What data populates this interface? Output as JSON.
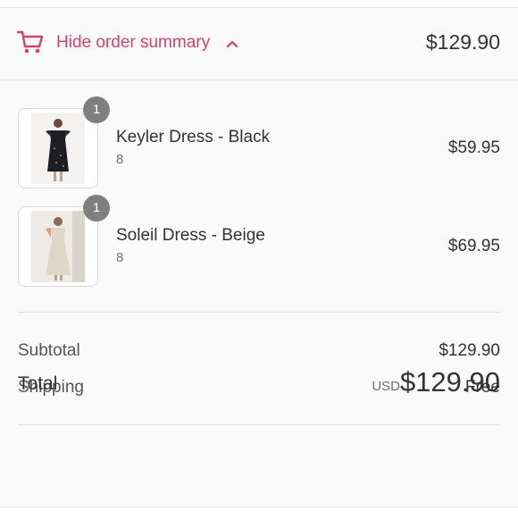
{
  "summary_toggle": {
    "label": "Hide order summary",
    "total": "$129.90",
    "icon": "cart-icon",
    "accent_color": "#d4426c"
  },
  "line_items": [
    {
      "name": "Keyler Dress - Black",
      "variant": "8",
      "price": "$59.95",
      "quantity": "1"
    },
    {
      "name": "Soleil Dress - Beige",
      "variant": "8",
      "price": "$69.95",
      "quantity": "1"
    }
  ],
  "costs": {
    "subtotal_label": "Subtotal",
    "subtotal_value": "$129.90",
    "shipping_label": "Shipping",
    "shipping_value": "Free"
  },
  "total": {
    "label": "Total",
    "currency": "USD",
    "amount": "$129.90"
  }
}
